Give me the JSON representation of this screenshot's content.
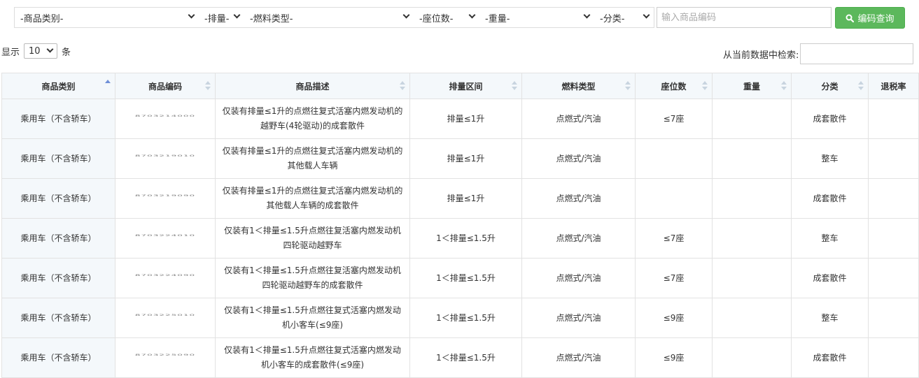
{
  "filters": {
    "category": "-商品类别-",
    "displacement": "-排量-",
    "fuel": "-燃料类型-",
    "seats": "-座位数-",
    "weight": "-重量-",
    "classification": "-分类-"
  },
  "search": {
    "placeholder": "输入商品编码",
    "button_label": "编码查询"
  },
  "length": {
    "prefix": "显示",
    "value": "10",
    "suffix": "条"
  },
  "table_filter": {
    "label": "从当前数据中检索:"
  },
  "table": {
    "columns": [
      "商品类别",
      "商品编码",
      "商品描述",
      "排量区间",
      "燃料类型",
      "座位数",
      "重量",
      "分类",
      "退税率"
    ],
    "rows": [
      [
        "乘用车（不含轿车）",
        "8703214000",
        "仅装有排量≤1升的点燃往复式活塞内燃发动机的越野车(4轮驱动)的成套散件",
        "排量≤1升",
        "点燃式/汽油",
        "≤7座",
        "",
        "成套散件",
        ""
      ],
      [
        "乘用车（不含轿车）",
        "8703219010",
        "仅装有排量≤1升的点燃往复式活塞内燃发动机的其他载人车辆",
        "排量≤1升",
        "点燃式/汽油",
        "",
        "",
        "整车",
        ""
      ],
      [
        "乘用车（不含轿车）",
        "8703219090",
        "仅装有排量≤1升的点燃往复式活塞内燃发动机的其他载人车辆的成套散件",
        "排量≤1升",
        "点燃式/汽油",
        "",
        "",
        "成套散件",
        ""
      ],
      [
        "乘用车（不含轿车）",
        "8703224010",
        "仅装有1＜排量≤1.5升点燃往复活塞内燃发动机四轮驱动越野车",
        "1＜排量≤1.5升",
        "点燃式/汽油",
        "≤7座",
        "",
        "整车",
        ""
      ],
      [
        "乘用车（不含轿车）",
        "8703224090",
        "仅装有1＜排量≤1.5升点燃往复活塞内燃发动机四轮驱动越野车的成套散件",
        "1＜排量≤1.5升",
        "点燃式/汽油",
        "≤7座",
        "",
        "成套散件",
        ""
      ],
      [
        "乘用车（不含轿车）",
        "8703225010",
        "仅装有1＜排量≤1.5升点燃往复式活塞内燃发动机小客车(≤9座)",
        "1＜排量≤1.5升",
        "点燃式/汽油",
        "≤9座",
        "",
        "整车",
        ""
      ],
      [
        "乘用车（不含轿车）",
        "8703225090",
        "仅装有1＜排量≤1.5升点燃往复式活塞内燃发动机小客车的成套散件(≤9座)",
        "1＜排量≤1.5升",
        "点燃式/汽油",
        "≤9座",
        "",
        "成套散件",
        ""
      ]
    ]
  },
  "colors": {
    "accent": "#5cb85c",
    "header_bg": "#f4f8fb",
    "sort_active": "#6f8fd8"
  }
}
